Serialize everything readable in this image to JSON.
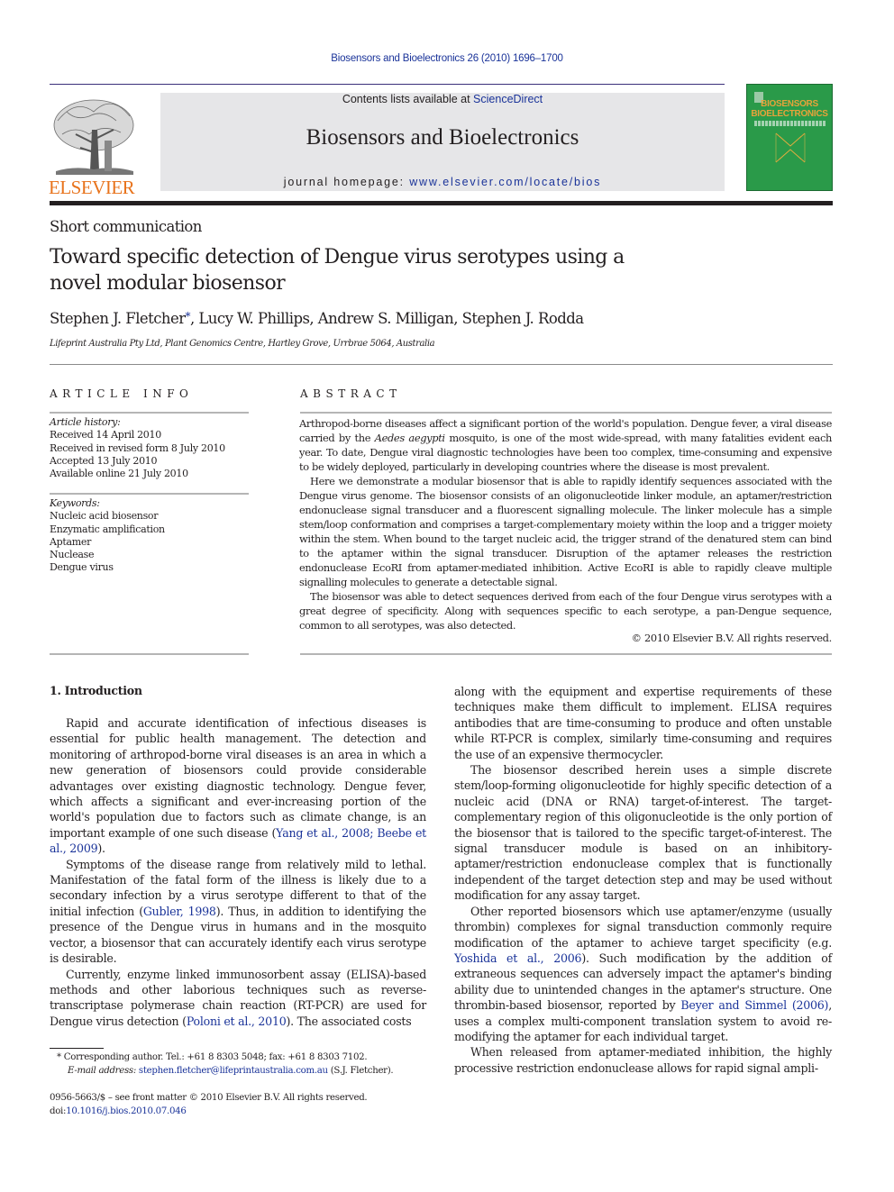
{
  "running_head": "Biosensors and Bioelectronics 26 (2010) 1696–1700",
  "masthead": {
    "publisher_logo_text": "ELSEVIER",
    "contents_prefix": "Contents lists available at ",
    "contents_link": "ScienceDirect",
    "journal_name": "Biosensors and Bioelectronics",
    "homepage_prefix": "journal homepage: ",
    "homepage_link": "www.elsevier.com/locate/bios",
    "cover_title_line1": "BIOSENSORS",
    "cover_title_line2": "BIOELECTRONICS",
    "cover_color": "#2a9a49"
  },
  "article": {
    "type": "Short communication",
    "title": "Toward specific detection of Dengue virus serotypes using a novel modular biosensor",
    "authors": [
      {
        "name": "Stephen J. Fletcher",
        "corresponding": true
      },
      {
        "name": "Lucy W. Phillips"
      },
      {
        "name": "Andrew S. Milligan"
      },
      {
        "name": "Stephen J. Rodda"
      }
    ],
    "authors_rest": ", Lucy W. Phillips, Andrew S. Milligan, Stephen J. Rodda",
    "first_author": "Stephen J. Fletcher",
    "corresponding_mark": "*",
    "affiliation": "Lifeprint Australia Pty Ltd, Plant Genomics Centre, Hartley Grove, Urrbrae 5064, Australia"
  },
  "article_info": {
    "heading": "ARTICLE INFO",
    "history_label": "Article history:",
    "history": [
      "Received 14 April 2010",
      "Received in revised form 8 July 2010",
      "Accepted 13 July 2010",
      "Available online 21 July 2010"
    ],
    "keywords_label": "Keywords:",
    "keywords": [
      "Nucleic acid biosensor",
      "Enzymatic amplification",
      "Aptamer",
      "Nuclease",
      "Dengue virus"
    ]
  },
  "abstract": {
    "heading": "ABSTRACT",
    "p1_a": "Arthropod-borne diseases affect a significant portion of the world's population. Dengue fever, a viral disease carried by the ",
    "p1_italic": "Aedes aegypti",
    "p1_b": " mosquito, is one of the most wide-spread, with many fatalities evident each year. To date, Dengue viral diagnostic technologies have been too complex, time-consuming and expensive to be widely deployed, particularly in developing countries where the disease is most prevalent.",
    "p2": "Here we demonstrate a modular biosensor that is able to rapidly identify sequences associated with the Dengue virus genome. The biosensor consists of an oligonucleotide linker module, an aptamer/restriction endonuclease signal transducer and a fluorescent signalling molecule. The linker molecule has a simple stem/loop conformation and comprises a target-complementary moiety within the loop and a trigger moiety within the stem. When bound to the target nucleic acid, the trigger strand of the denatured stem can bind to the aptamer within the signal transducer. Disruption of the aptamer releases the restriction endonuclease EcoRI from aptamer-mediated inhibition. Active EcoRI is able to rapidly cleave multiple signalling molecules to generate a detectable signal.",
    "p3": "The biosensor was able to detect sequences derived from each of the four Dengue virus serotypes with a great degree of specificity. Along with sequences specific to each serotype, a pan-Dengue sequence, common to all serotypes, was also detected.",
    "copyright": "© 2010 Elsevier B.V. All rights reserved."
  },
  "body": {
    "section_heading": "1.  Introduction",
    "left": {
      "p1_a": "Rapid and accurate identification of infectious diseases is essential for public health management. The detection and monitoring of arthropod-borne viral diseases is an area in which a new generation of biosensors could provide considerable advantages over existing diagnostic technology. Dengue fever, which affects a significant and ever-increasing portion of the world's population due to factors such as climate change, is an important example of one such disease (",
      "p1_cite1": "Yang et al., 2008",
      "p1_sep": "; ",
      "p1_cite2": "Beebe et al., 2009",
      "p1_b": ").",
      "p2_a": "Symptoms of the disease range from relatively mild to lethal. Manifestation of the fatal form of the illness is likely due to a secondary infection by a virus serotype different to that of the initial infection (",
      "p2_cite": "Gubler, 1998",
      "p2_b": "). Thus, in addition to identifying the presence of the Dengue virus in humans and in the mosquito vector, a biosensor that can accurately identify each virus serotype is desirable.",
      "p3_a": "Currently, enzyme linked immunosorbent assay (ELISA)-based methods and other laborious techniques such as reverse-transcriptase polymerase chain reaction (RT-PCR) are used for Dengue virus detection (",
      "p3_cite": "Poloni et al., 2010",
      "p3_b": "). The associated costs"
    },
    "right": {
      "p1": "along with the equipment and expertise requirements of these techniques make them difficult to implement. ELISA requires antibodies that are time-consuming to produce and often unstable while RT-PCR is complex, similarly time-consuming and requires the use of an expensive thermocycler.",
      "p2": "The biosensor described herein uses a simple discrete stem/loop-forming oligonucleotide for highly specific detection of a nucleic acid (DNA or RNA) target-of-interest. The target-complementary region of this oligonucleotide is the only portion of the biosensor that is tailored to the specific target-of-interest. The signal transducer module is based on an inhibitory-aptamer/restriction endonuclease complex that is functionally independent of the target detection step and may be used without modification for any assay target.",
      "p3_a": "Other reported biosensors which use aptamer/enzyme (usually thrombin) complexes for signal transduction commonly require modification of the aptamer to achieve target specificity (e.g. ",
      "p3_cite1": "Yoshida et al., 2006",
      "p3_b": "). Such modification by the addition of extraneous sequences can adversely impact the aptamer's binding ability due to unintended changes in the aptamer's structure. One thrombin-based biosensor, reported by ",
      "p3_cite2": "Beyer and Simmel (2006)",
      "p3_c": ", uses a complex multi-component translation system to avoid re-modifying the aptamer for each individual target.",
      "p4": "When released from aptamer-mediated inhibition, the highly processive restriction endonuclease allows for rapid signal ampli-"
    }
  },
  "footnote": {
    "mark": "*",
    "line1": " Corresponding author. Tel.: +61 8 8303 5048; fax: +61 8 8303 7102.",
    "email_label": "E-mail address: ",
    "email": "stephen.fletcher@lifeprintaustralia.com.au",
    "email_suffix": " (S.J. Fletcher)."
  },
  "bottom": {
    "issn_line": "0956-5663/$ – see front matter © 2010 Elsevier B.V. All rights reserved.",
    "doi_prefix": "doi:",
    "doi": "10.1016/j.bios.2010.07.046"
  }
}
